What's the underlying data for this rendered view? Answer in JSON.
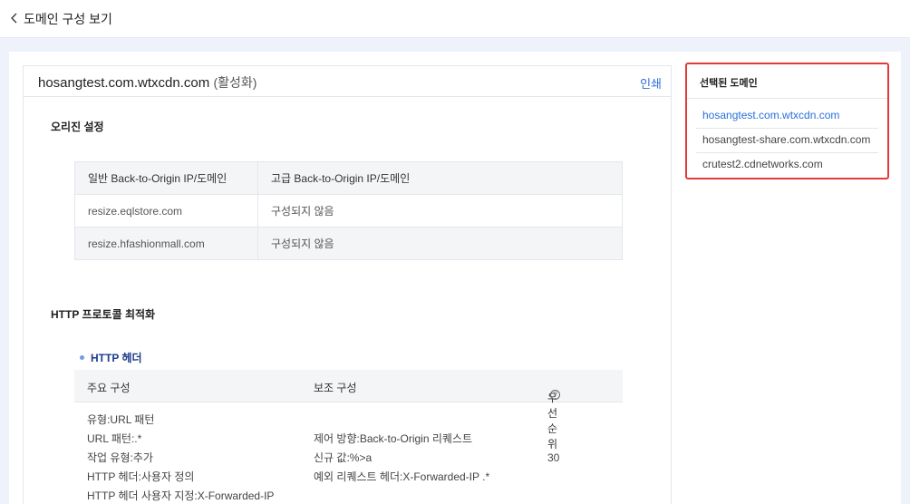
{
  "header": {
    "back_icon": "chevron-left-icon",
    "title": "도메인 구성 보기"
  },
  "domain": {
    "name": "hosangtest.com.wtxcdn.com",
    "status": "(활성화)",
    "print_label": "인쇄"
  },
  "origin": {
    "title": "오리진 설정",
    "columns": [
      "일반 Back-to-Origin IP/도메인",
      "고급 Back-to-Origin IP/도메인"
    ],
    "rows": [
      [
        "resize.eqlstore.com",
        "구성되지 않음"
      ],
      [
        "resize.hfashionmall.com",
        "구성되지 않음"
      ]
    ]
  },
  "http": {
    "title": "HTTP 프로토콜 최적화",
    "subsection": "HTTP 헤더",
    "columns": {
      "main": "주요 구성",
      "secondary": "보조 구성",
      "priority": "우선순위",
      "help_icon": "question-circle-icon"
    },
    "row": {
      "main": [
        "유형:URL 패턴",
        "URL 패턴:.*",
        "작업 유형:추가",
        "HTTP 헤더:사용자 정의",
        "HTTP 헤더 사용자 지정:X-Forwarded-IP"
      ],
      "secondary": [
        "제어 방향:Back-to-Origin 리퀘스트",
        "신규 값:%>a",
        "예외 리퀘스트 헤더:X-Forwarded-IP .*"
      ],
      "priority": "30"
    }
  },
  "side": {
    "title": "선택된 도메인",
    "items": [
      "hosangtest.com.wtxcdn.com",
      "hosangtest-share.com.wtxcdn.com",
      "crutest2.cdnetworks.com"
    ],
    "active_index": 0
  },
  "colors": {
    "link": "#2a6fdb",
    "highlight_border": "#e23b3b",
    "subsection_title": "#1f3c8c"
  }
}
